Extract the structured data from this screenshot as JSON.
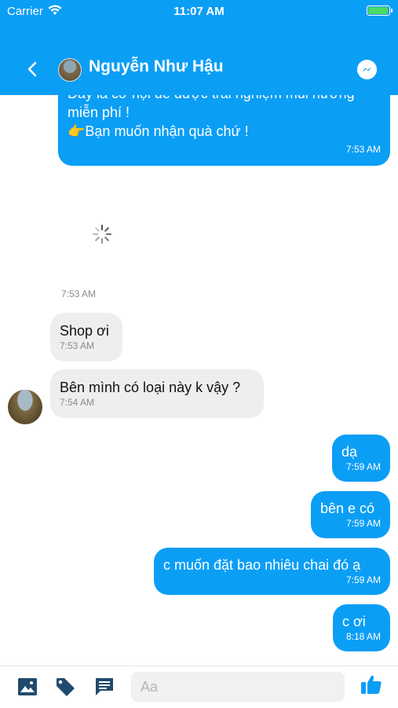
{
  "status_bar": {
    "carrier": "Carrier",
    "time": "11:07 AM",
    "battery_level": 1.0
  },
  "header": {
    "title": "Nguyễn Như Hậu",
    "back_icon": "chevron-left-icon",
    "action_icon": "messenger-icon"
  },
  "messages": [
    {
      "side": "out",
      "lines": [
        "Đây là cơ hội để được trải nghiệm mùi hương",
        "miễn phí !",
        "👉Bạn muốn nhận quà chứ !"
      ],
      "time": "7:53 AM"
    },
    {
      "type": "image-loading",
      "time": "7:53 AM"
    },
    {
      "side": "in",
      "text": "Shop ơi",
      "time": "7:53 AM"
    },
    {
      "side": "in",
      "text": "Bên mình có loại này k vậy ?",
      "time": "7:54 AM"
    },
    {
      "side": "out",
      "text": "dạ",
      "time": "7:59 AM"
    },
    {
      "side": "out",
      "text": "bên e có",
      "time": "7:59 AM"
    },
    {
      "side": "out",
      "text": "c muốn đặt bao nhiêu chai đó ạ",
      "time": "7:59 AM"
    },
    {
      "side": "out",
      "text": "c ơi",
      "time": "8:18 AM"
    }
  ],
  "composer": {
    "placeholder": "Aa",
    "icons": [
      "image-icon",
      "tag-icon",
      "quick-reply-icon",
      "like-icon"
    ]
  },
  "colors": {
    "brand": "#0b9ef5",
    "incoming": "#eeeef0"
  }
}
